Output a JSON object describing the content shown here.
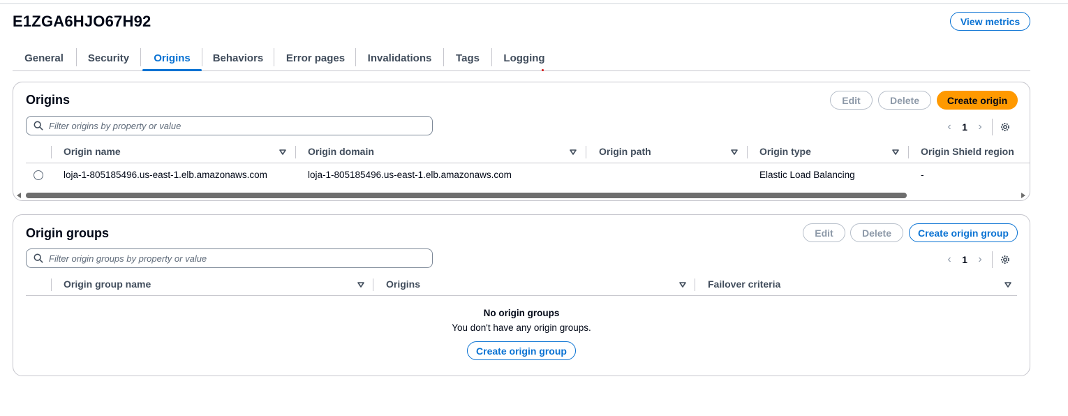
{
  "distribution": {
    "id": "E1ZGA6HJO67H92",
    "view_metrics_label": "View metrics"
  },
  "tabs": [
    {
      "label": "General",
      "active": false
    },
    {
      "label": "Security",
      "active": false
    },
    {
      "label": "Origins",
      "active": true
    },
    {
      "label": "Behaviors",
      "active": false
    },
    {
      "label": "Error pages",
      "active": false
    },
    {
      "label": "Invalidations",
      "active": false
    },
    {
      "label": "Tags",
      "active": false
    },
    {
      "label": "Logging",
      "active": false
    }
  ],
  "origins": {
    "title": "Origins",
    "edit_label": "Edit",
    "delete_label": "Delete",
    "create_label": "Create origin",
    "filter_placeholder": "Filter origins by property or value",
    "page": "1",
    "columns": [
      "Origin name",
      "Origin domain",
      "Origin path",
      "Origin type",
      "Origin Shield region"
    ],
    "rows": [
      {
        "name": "loja-1-805185496.us-east-1.elb.amazonaws.com",
        "domain": "loja-1-805185496.us-east-1.elb.amazonaws.com",
        "path": "",
        "type": "Elastic Load Balancing",
        "shield": "-"
      }
    ]
  },
  "origin_groups": {
    "title": "Origin groups",
    "edit_label": "Edit",
    "delete_label": "Delete",
    "create_label": "Create origin group",
    "filter_placeholder": "Filter origin groups by property or value",
    "page": "1",
    "columns": [
      "Origin group name",
      "Origins",
      "Failover criteria"
    ],
    "empty_title": "No origin groups",
    "empty_desc": "You don't have any origin groups.",
    "empty_create_label": "Create origin group"
  },
  "colors": {
    "accent": "#0972d3",
    "primary_button": "#ff9900",
    "text": "#000716",
    "border": "#c6c6cd"
  }
}
